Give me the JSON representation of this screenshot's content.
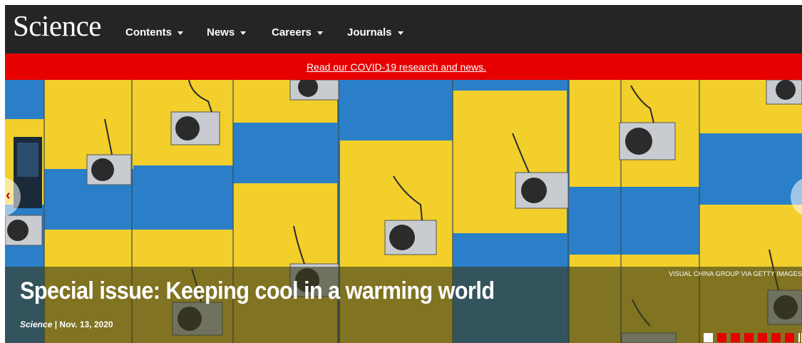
{
  "header": {
    "logo": "Science",
    "nav": [
      {
        "label": "Contents"
      },
      {
        "label": "News"
      },
      {
        "label": "Careers"
      },
      {
        "label": "Journals"
      }
    ]
  },
  "alert": {
    "link_text": "Read our COVID-19 research and news."
  },
  "hero": {
    "headline": "Special issue: Keeping cool in a warming world",
    "byline_journal": "Science",
    "byline_date": " | Nov. 13, 2020",
    "photo_credit": "VISUAL CHINA GROUP VIA GETTY IMAGES",
    "slide_count": 8,
    "active_slide": 1
  },
  "colors": {
    "header_bg": "#252525",
    "alert_bg": "#e60000",
    "wall_blue": "#2a7fc8",
    "wall_yellow": "#f2cf2a"
  },
  "icons": [
    "chevron-down-icon",
    "chevron-left-icon",
    "chevron-right-icon",
    "pause-icon"
  ]
}
